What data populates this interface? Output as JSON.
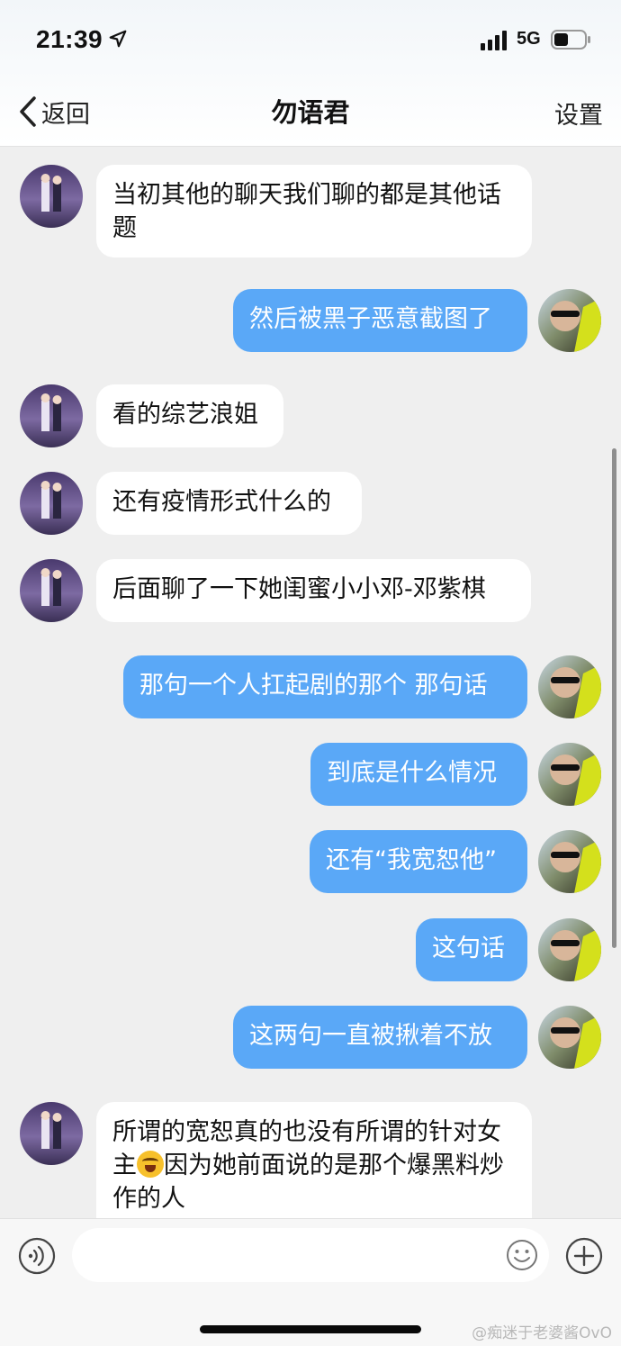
{
  "status_bar": {
    "time": "21:39",
    "network": "5G"
  },
  "nav": {
    "back_label": "返回",
    "title": "勿语君",
    "settings_label": "设置"
  },
  "messages": [
    {
      "side": "in",
      "text": "当初其他的聊天我们聊的都是其他话题"
    },
    {
      "side": "out",
      "text": "然后被黑子恶意截图了"
    },
    {
      "side": "in",
      "text": "看的综艺浪姐"
    },
    {
      "side": "in",
      "text": "还有疫情形式什么的"
    },
    {
      "side": "in",
      "text": "后面聊了一下她闺蜜小小邓-邓紫棋"
    },
    {
      "side": "out",
      "text": "那句一个人扛起剧的那个 那句话"
    },
    {
      "side": "out",
      "text": "到底是什么情况"
    },
    {
      "side": "out",
      "text": "还有“我宽恕他”"
    },
    {
      "side": "out",
      "text": "这句话"
    },
    {
      "side": "out",
      "text": "这两句一直被揪着不放"
    },
    {
      "side": "in",
      "text_before": "所谓的宽恕真的也没有所谓的针对女主",
      "emoji": "laughing-crying-emoji",
      "text_after": "因为她前面说的是那个爆黑料炒作的人"
    }
  ],
  "input_bar": {
    "field_value": ""
  },
  "watermark": "@痴迷于老婆酱OvO",
  "colors": {
    "outgoing_bubble": "#5aa8f7",
    "incoming_bubble": "#ffffff",
    "background": "#efefef"
  }
}
